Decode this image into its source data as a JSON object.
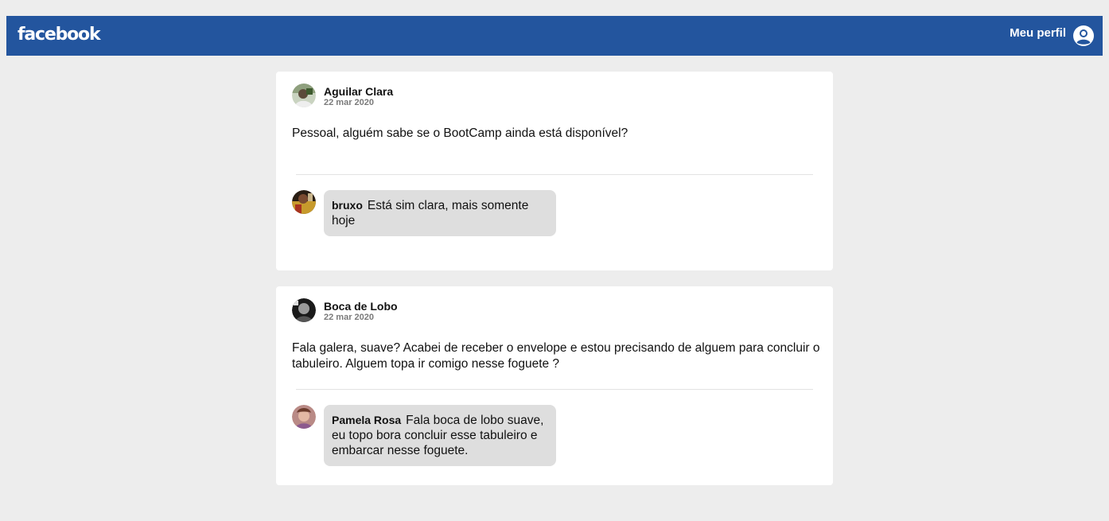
{
  "header": {
    "logo": "facebook",
    "profile_label": "Meu perfil",
    "profile_icon": "user-circle-icon",
    "bg_color": "#23559e"
  },
  "posts": [
    {
      "author": "Aguilar Clara",
      "date": "22 mar 2020",
      "text": "Pessoal, alguém sabe se o BootCamp ainda está disponível?",
      "comments": [
        {
          "author": "bruxo",
          "text": "Está sim clara, mais somente hoje"
        }
      ]
    },
    {
      "author": "Boca de Lobo",
      "date": "22 mar 2020",
      "text": "Fala galera, suave? Acabei de receber o envelope e estou precisando de alguem para concluir o tabuleiro. Alguem topa ir comigo nesse foguete ?",
      "comments": [
        {
          "author": "Pamela Rosa",
          "text": "Fala boca de lobo suave, eu topo bora concluir esse tabuleiro e embarcar nesse foguete."
        }
      ]
    }
  ]
}
